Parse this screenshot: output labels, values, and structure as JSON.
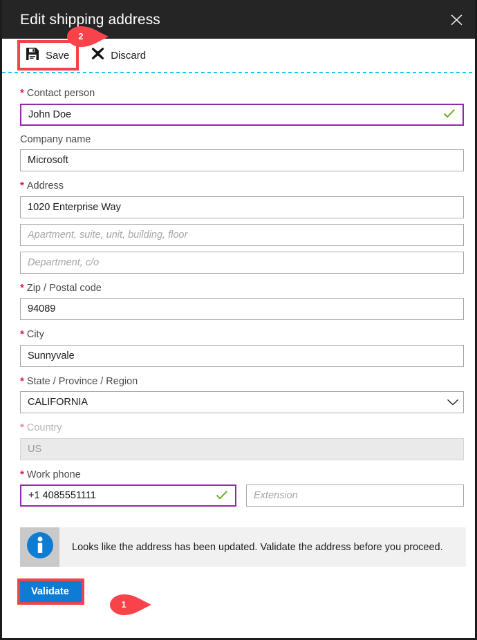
{
  "window": {
    "title": "Edit shipping address",
    "close_icon": "close-icon"
  },
  "commandbar": {
    "save_label": "Save",
    "save_icon": "save-floppy-icon",
    "discard_label": "Discard",
    "discard_icon": "x-discard-icon"
  },
  "form": {
    "contact_person": {
      "label": "Contact person",
      "required": true,
      "value": "John Doe",
      "state": "valid"
    },
    "company_name": {
      "label": "Company name",
      "required": false,
      "value": "Microsoft",
      "state": "normal"
    },
    "address": {
      "label": "Address",
      "required": true,
      "value": "1020 Enterprise Way",
      "state": "normal"
    },
    "address_line2": {
      "placeholder": "Apartment, suite, unit, building, floor",
      "value": ""
    },
    "address_line3": {
      "placeholder": "Department, c/o",
      "value": ""
    },
    "zip": {
      "label": "Zip / Postal code",
      "required": true,
      "value": "94089",
      "state": "normal"
    },
    "city": {
      "label": "City",
      "required": true,
      "value": "Sunnyvale",
      "state": "normal"
    },
    "state_province": {
      "label": "State / Province / Region",
      "required": true,
      "value": "CALIFORNIA",
      "state": "normal",
      "chevron_icon": "chevron-down-icon"
    },
    "country": {
      "label": "Country",
      "required": true,
      "value": "US",
      "state": "disabled"
    },
    "work_phone": {
      "label": "Work phone",
      "required": true,
      "value": "+1 4085551111",
      "state": "valid"
    },
    "extension": {
      "placeholder": "Extension",
      "value": ""
    }
  },
  "info_bar": {
    "icon": "info-circle-icon",
    "message": "Looks like the address has been updated. Validate the address before you proceed."
  },
  "actions": {
    "validate_label": "Validate"
  },
  "callouts": [
    {
      "number": "1",
      "target": "validate-button"
    },
    {
      "number": "2",
      "target": "save-button"
    }
  ],
  "colors": {
    "titlebar_bg": "#252525",
    "accent_blue": "#0f7cd4",
    "highlight_red": "#f4424a",
    "valid_border_purple": "#8f2aa5",
    "valid_check_green": "#6fa828",
    "required_red": "#e3193c",
    "dotted_line_cyan": "#22c3f5",
    "info_bg": "#f1f1f1"
  }
}
